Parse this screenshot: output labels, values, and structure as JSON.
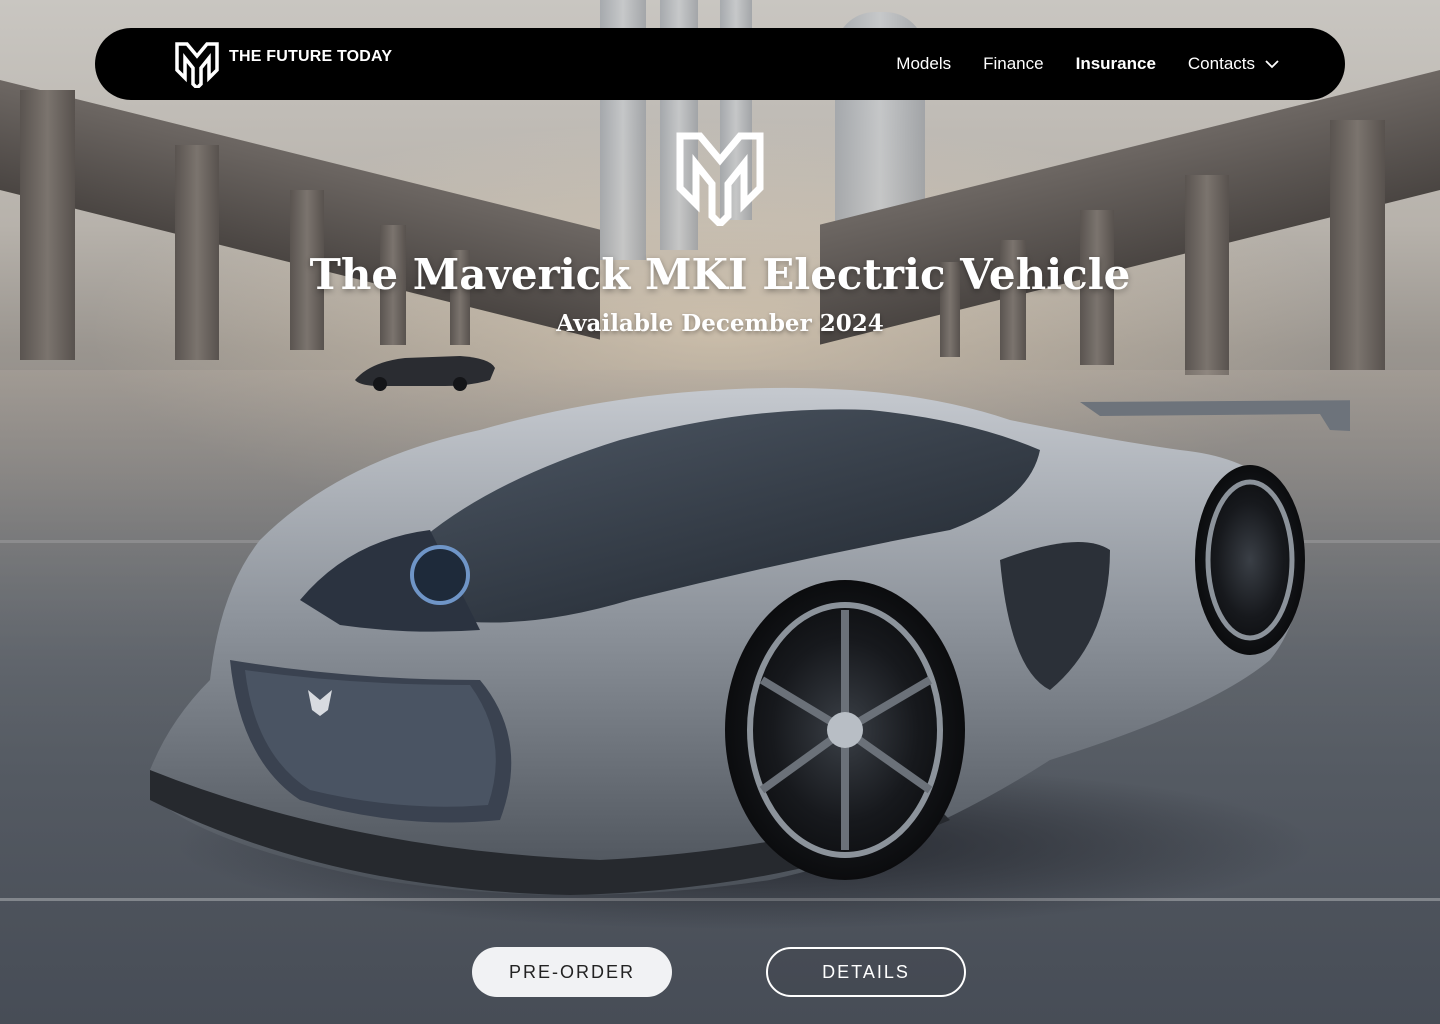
{
  "nav": {
    "brand_name": "THE FUTURE TODAY",
    "brand_logo_icon": "maverick-logo-icon",
    "links": [
      {
        "label": "Models",
        "active": false
      },
      {
        "label": "Finance",
        "active": false
      },
      {
        "label": "Insurance",
        "active": true
      },
      {
        "label": "Contacts",
        "active": false,
        "has_dropdown": true
      }
    ],
    "dropdown_icon": "chevron-down-icon"
  },
  "hero": {
    "emblem_icon": "maverick-emblem-icon",
    "title": "The Maverick MKI Electric Vehicle",
    "subtitle": "Available December 2024",
    "background_image": "futuristic-electric-supercar-under-overpass"
  },
  "actions": {
    "primary_label": "PRE-ORDER",
    "secondary_label": "DETAILS"
  },
  "colors": {
    "navbar_bg": "#000000",
    "text": "#ffffff",
    "primary_button_bg": "#f1f2f4",
    "primary_button_text": "#222222"
  }
}
